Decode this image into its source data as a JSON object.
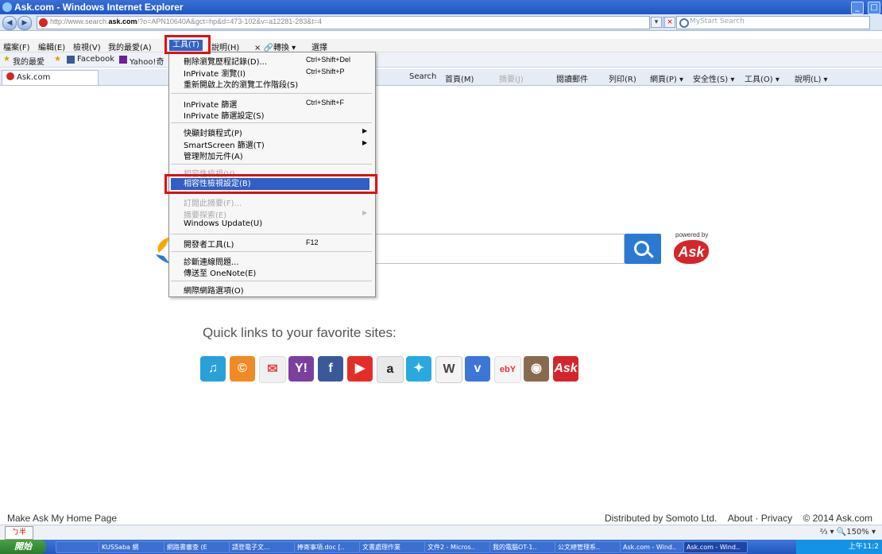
{
  "window": {
    "title": "Ask.com - Windows Internet Explorer",
    "buttons": [
      "_",
      "□"
    ]
  },
  "address": {
    "url_prefix": "http://www.search.",
    "url_domain": "ask.com",
    "url_suffix": "/?o=APN10640A&gct=hp&d=473-102&v=a12281-283&t=4",
    "search_placeholder": "MyStart Search"
  },
  "menubar": {
    "items": [
      "檔案(F)",
      "編輯(E)",
      "檢視(V)",
      "我的最愛(A)",
      "工具(T)",
      "說明(H)"
    ],
    "convert": "× 🔗轉換 ▾",
    "select": "選擇"
  },
  "favbar": {
    "favorites": "我的最愛",
    "facebook": "Facebook",
    "yahoo": "Yahoo!奇"
  },
  "tab": {
    "title": "Ask.com"
  },
  "cmdbar": {
    "search": "Search",
    "home": "首頁(M)",
    "feeds": "摘要(J)",
    "mail": "閱讀郵件",
    "print": "列印(R)",
    "page": "網頁(P) ▾",
    "safety": "安全性(S) ▾",
    "tools": "工具(O) ▾",
    "help": "說明(L) ▾"
  },
  "toolsmenu": {
    "delete_history": "刪除瀏覽歷程記錄(D)...",
    "delete_history_sc": "Ctrl+Shift+Del",
    "inprivate": "InPrivate 瀏覽(I)",
    "inprivate_sc": "Ctrl+Shift+P",
    "reopen": "重新開啟上次的瀏覽工作階段(S)",
    "inprivate_filter": "InPrivate 篩選",
    "inprivate_filter_sc": "Ctrl+Shift+F",
    "inprivate_filter_settings": "InPrivate 篩選設定(S)",
    "popup_blocker": "快顯封鎖程式(P)",
    "smartscreen": "SmartScreen 篩選(T)",
    "addons": "管理附加元件(A)",
    "compat_view": "相容性檢視(V)",
    "compat_settings": "相容性檢視設定(B)",
    "subscribe": "訂閱此摘要(F)...",
    "feed_discovery": "摘要探索(E)",
    "windows_update": "Windows Update(U)",
    "dev_tools": "開發者工具(L)",
    "dev_tools_sc": "F12",
    "diagnose": "診斷連線問題...",
    "onenote": "傳送至 OneNote(E)",
    "options": "網際網路選項(O)"
  },
  "page": {
    "powered_by": "powered by",
    "ask_logo": "Ask",
    "quicklinks_title": "Quick links to your favorite sites:",
    "quicklinks": [
      "Ask",
      "a",
      "W",
      "Y!",
      "f",
      "ebY",
      "Ask"
    ]
  },
  "footer": {
    "make_home": "Make Ask My Home Page",
    "distributed": "Distributed by Somoto Ltd.",
    "about": "About · Privacy",
    "copyright": "© 2014 Ask.com"
  },
  "statusbar": {
    "ime": "ㄅ半",
    "zoom": "⅔ ▾ 🔍150% ▾"
  },
  "taskbar": {
    "start": "開始",
    "items": [
      "KUSSaba 網",
      "網路書審查 (E",
      "請登電子文...",
      "捧寄事項.doc [..",
      "文書處理作業",
      "文件2 - Micros..",
      "我的電腦OT-1..",
      "公文總管理系..",
      "Ask.com - Wind..",
      "Ask.com - Wind.."
    ],
    "clock": "上午11:2"
  },
  "colors": {
    "accent": "#2a7ad3",
    "highlight": "#2e5fc4",
    "annotation": "#e01010",
    "ask_red": "#d4262a"
  }
}
